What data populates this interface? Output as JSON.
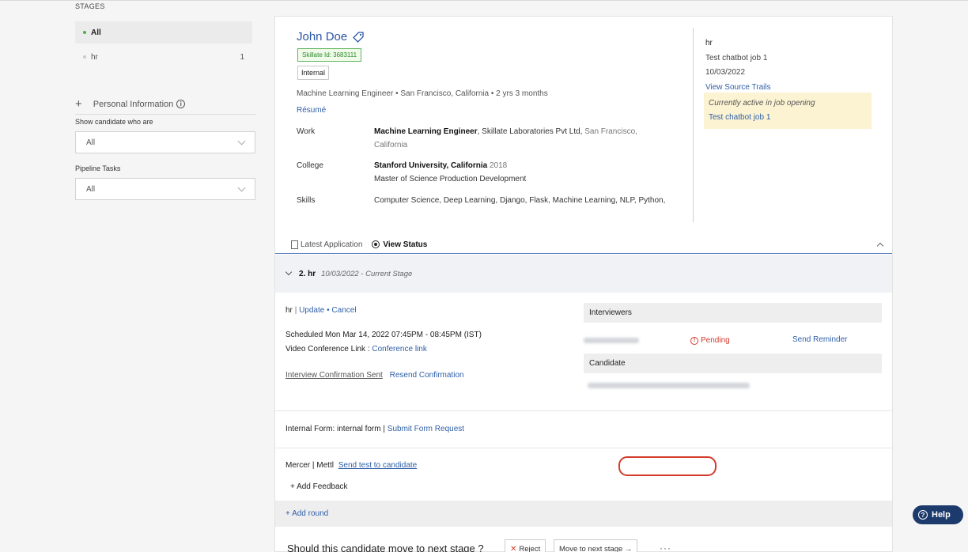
{
  "sidebar": {
    "stages_title": "STAGES",
    "stages": [
      {
        "label": "All",
        "count": "",
        "active": true,
        "dot_color": "#4caf50"
      },
      {
        "label": "hr",
        "count": "1",
        "active": false,
        "dot_color": "#c9c9c9"
      }
    ],
    "personal_info_label": "Personal Information",
    "show_candidate_label": "Show candidate who are",
    "show_candidate_value": "All",
    "pipeline_tasks_label": "Pipeline Tasks",
    "pipeline_tasks_value": "All"
  },
  "candidate": {
    "name": "John Doe",
    "skillate_id": "Skillate Id: 3683111",
    "badge": "Internal",
    "headline": "Machine Learning Engineer • San Francisco, California • 2 yrs 3 months",
    "resume_link": "Résumé",
    "work_label": "Work",
    "work_title": "Machine Learning Engineer",
    "work_company": ", Skillate Laboratories Pvt Ltd,",
    "work_location": " San Francisco, California",
    "college_label": "College",
    "college_name": "Stanford University, California",
    "college_year": " 2018",
    "college_degree": "Master of Science Production Development",
    "skills_label": "Skills",
    "skills": "Computer Science, Deep Learning, Django, Flask, Machine Learning, NLP, Python,"
  },
  "job_side": {
    "stage": "hr",
    "job": "Test chatbot job 1",
    "date": "10/03/2022",
    "source_trails": "View Source Trails",
    "active_note": "Currently active in job opening",
    "active_job": "Test chatbot job 1"
  },
  "application_bar": {
    "latest_application": "Latest Application",
    "view_status": "View Status"
  },
  "stage_detail": {
    "name": "2. hr",
    "date_note": "10/03/2022 - Current Stage",
    "stage_name": "hr",
    "separator": "|",
    "update": "Update",
    "bullet": "•",
    "cancel": "Cancel",
    "scheduled": "Scheduled Mon Mar 14, 2022 07:45PM - 08:45PM (IST)",
    "video_label": "Video Conference Link : ",
    "conference_link": "Conference link",
    "confirmation_sent": "Interview Confirmation Sent",
    "resend": "Resend Confirmation",
    "interviewers_label": "Interviewers",
    "pending": "Pending",
    "send_reminder": "Send Reminder",
    "candidate_label": "Candidate"
  },
  "forms": {
    "internal_form": "Internal Form: internal form",
    "separator": "|",
    "submit_request": "Submit Form Request"
  },
  "assessment": {
    "provider": "Mercer | Mettl",
    "send_test": "Send test to candidate",
    "add_feedback": "+ Add Feedback"
  },
  "add_round": "+ Add round",
  "next_stage": {
    "question": "Should this candidate move to next stage ?",
    "reject": "Reject",
    "move": "Move to next stage →",
    "more": "···"
  },
  "help": "Help",
  "colors": {
    "link": "#2f5fa7",
    "accent_green": "#4caf50",
    "pending_red": "#d23a2e",
    "help_bg": "#1c3a6b"
  }
}
